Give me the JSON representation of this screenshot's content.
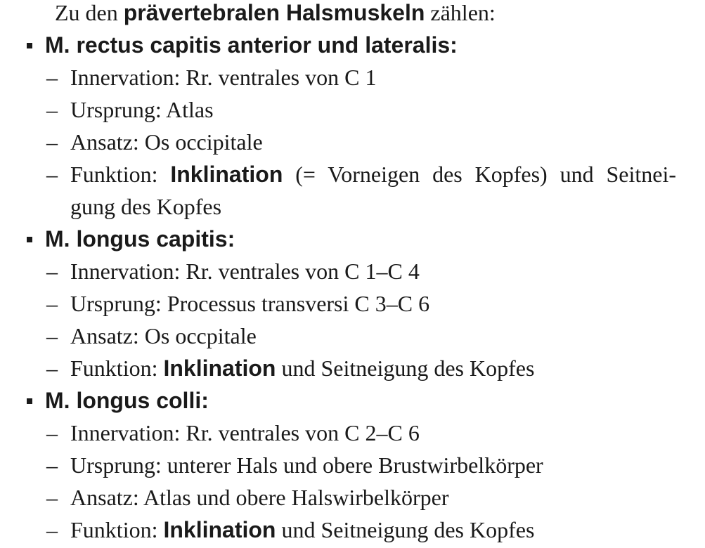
{
  "intro": {
    "prefix": "Zu den ",
    "bold": "prävertebralen Halsmuskeln",
    "suffix": " zählen:"
  },
  "muscles": [
    {
      "name": "M. rectus capitis anterior und lateralis:",
      "items": [
        "Innervation: Rr. ventrales von C 1",
        "Ursprung: Atlas",
        "Ansatz: Os occipitale"
      ],
      "function": {
        "label": "Funktion: ",
        "bold": "Inklination",
        "rest": " (= Vorneigen des Kopfes) und Seitnei-",
        "continuation": "gung des Kopfes"
      }
    },
    {
      "name": "M. longus capitis:",
      "items": [
        "Innervation: Rr. ventrales von C 1–C 4",
        "Ursprung: Processus transversi C 3–C 6",
        "Ansatz: Os occpitale"
      ],
      "function": {
        "label": "Funktion: ",
        "bold": "Inklination",
        "rest": " und Seitneigung des Kopfes"
      }
    },
    {
      "name": "M. longus colli:",
      "items": [
        "Innervation: Rr. ventrales von C 2–C 6",
        "Ursprung: unterer Hals und obere Brustwirbelkörper",
        "Ansatz: Atlas und obere Halswirbelkörper"
      ],
      "function": {
        "label": "Funktion: ",
        "bold": "Inklination",
        "rest": " und Seitneigung des Kopfes"
      }
    }
  ],
  "dash": "–"
}
